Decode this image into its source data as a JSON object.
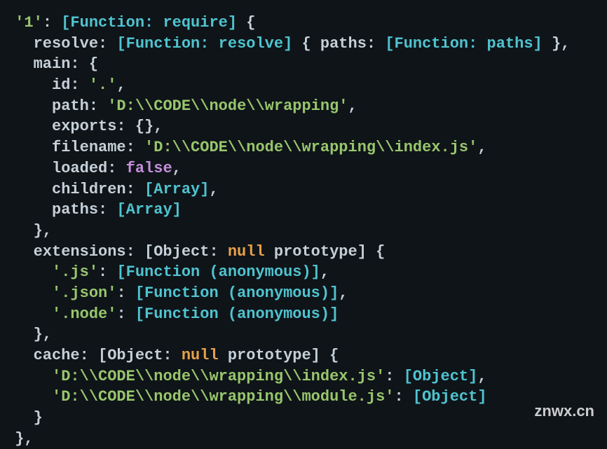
{
  "watermark": "znwx.cn",
  "lines": [
    {
      "id": "l0",
      "segments": [
        {
          "cls": "base",
          "t": " "
        },
        {
          "cls": "string",
          "t": "'1'"
        },
        {
          "cls": "base",
          "t": ": "
        },
        {
          "cls": "cyan",
          "t": "[Function: require]"
        },
        {
          "cls": "base",
          "t": " {"
        }
      ]
    },
    {
      "id": "l1",
      "segments": [
        {
          "cls": "base",
          "t": "   resolve: "
        },
        {
          "cls": "cyan",
          "t": "[Function: resolve]"
        },
        {
          "cls": "base",
          "t": " { paths: "
        },
        {
          "cls": "cyan",
          "t": "[Function: paths]"
        },
        {
          "cls": "base",
          "t": " },"
        }
      ]
    },
    {
      "id": "l2",
      "segments": [
        {
          "cls": "base",
          "t": "   main: {"
        }
      ]
    },
    {
      "id": "l3",
      "segments": [
        {
          "cls": "base",
          "t": "     id: "
        },
        {
          "cls": "string",
          "t": "'.'"
        },
        {
          "cls": "base",
          "t": ","
        }
      ]
    },
    {
      "id": "l4",
      "segments": [
        {
          "cls": "base",
          "t": "     path: "
        },
        {
          "cls": "string",
          "t": "'D:\\\\CODE\\\\node\\\\wrapping'"
        },
        {
          "cls": "base",
          "t": ","
        }
      ]
    },
    {
      "id": "l5",
      "segments": [
        {
          "cls": "base",
          "t": "     exports: {},"
        }
      ]
    },
    {
      "id": "l6",
      "segments": [
        {
          "cls": "base",
          "t": "     filename: "
        },
        {
          "cls": "string",
          "t": "'D:\\\\CODE\\\\node\\\\wrapping\\\\index.js'"
        },
        {
          "cls": "base",
          "t": ","
        }
      ]
    },
    {
      "id": "l7",
      "segments": [
        {
          "cls": "base",
          "t": "     loaded: "
        },
        {
          "cls": "purple",
          "t": "false"
        },
        {
          "cls": "base",
          "t": ","
        }
      ]
    },
    {
      "id": "l8",
      "segments": [
        {
          "cls": "base",
          "t": "     children: "
        },
        {
          "cls": "cyan",
          "t": "[Array]"
        },
        {
          "cls": "base",
          "t": ","
        }
      ]
    },
    {
      "id": "l9",
      "segments": [
        {
          "cls": "base",
          "t": "     paths: "
        },
        {
          "cls": "cyan",
          "t": "[Array]"
        }
      ]
    },
    {
      "id": "l10",
      "segments": [
        {
          "cls": "base",
          "t": "   },"
        }
      ]
    },
    {
      "id": "l11",
      "segments": [
        {
          "cls": "base",
          "t": "   extensions: [Object: "
        },
        {
          "cls": "orange",
          "t": "null"
        },
        {
          "cls": "base",
          "t": " prototype] {"
        }
      ]
    },
    {
      "id": "l12",
      "segments": [
        {
          "cls": "base",
          "t": "     "
        },
        {
          "cls": "string",
          "t": "'.js'"
        },
        {
          "cls": "base",
          "t": ": "
        },
        {
          "cls": "cyan",
          "t": "[Function (anonymous)]"
        },
        {
          "cls": "base",
          "t": ","
        }
      ]
    },
    {
      "id": "l13",
      "segments": [
        {
          "cls": "base",
          "t": "     "
        },
        {
          "cls": "string",
          "t": "'.json'"
        },
        {
          "cls": "base",
          "t": ": "
        },
        {
          "cls": "cyan",
          "t": "[Function (anonymous)]"
        },
        {
          "cls": "base",
          "t": ","
        }
      ]
    },
    {
      "id": "l14",
      "segments": [
        {
          "cls": "base",
          "t": "     "
        },
        {
          "cls": "string",
          "t": "'.node'"
        },
        {
          "cls": "base",
          "t": ": "
        },
        {
          "cls": "cyan",
          "t": "[Function (anonymous)]"
        }
      ]
    },
    {
      "id": "l15",
      "segments": [
        {
          "cls": "base",
          "t": "   },"
        }
      ]
    },
    {
      "id": "l16",
      "segments": [
        {
          "cls": "base",
          "t": "   cache: [Object: "
        },
        {
          "cls": "orange",
          "t": "null"
        },
        {
          "cls": "base",
          "t": " prototype] {"
        }
      ]
    },
    {
      "id": "l17",
      "segments": [
        {
          "cls": "base",
          "t": "     "
        },
        {
          "cls": "string",
          "t": "'D:\\\\CODE\\\\node\\\\wrapping\\\\index.js'"
        },
        {
          "cls": "base",
          "t": ": "
        },
        {
          "cls": "cyan",
          "t": "[Object]"
        },
        {
          "cls": "base",
          "t": ","
        }
      ]
    },
    {
      "id": "l18",
      "segments": [
        {
          "cls": "base",
          "t": "     "
        },
        {
          "cls": "string",
          "t": "'D:\\\\CODE\\\\node\\\\wrapping\\\\module.js'"
        },
        {
          "cls": "base",
          "t": ": "
        },
        {
          "cls": "cyan",
          "t": "[Object]"
        }
      ]
    },
    {
      "id": "l19",
      "segments": [
        {
          "cls": "base",
          "t": "   }"
        }
      ]
    },
    {
      "id": "l20",
      "segments": [
        {
          "cls": "base",
          "t": " },"
        }
      ]
    }
  ]
}
